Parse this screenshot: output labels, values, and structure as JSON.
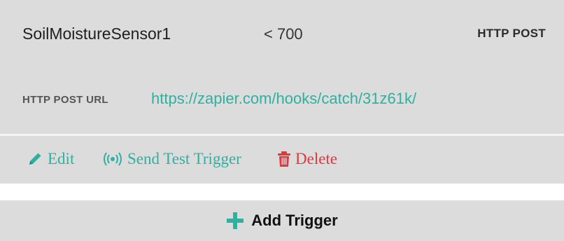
{
  "trigger": {
    "sensor_name": "SoilMoistureSensor1",
    "condition": "< 700",
    "method": "HTTP POST",
    "url_label": "HTTP POST URL",
    "url": "https://zapier.com/hooks/catch/31z61k/"
  },
  "actions": {
    "edit_label": "Edit",
    "test_label": "Send Test Trigger",
    "delete_label": "Delete"
  },
  "add_trigger": {
    "label": "Add Trigger"
  },
  "icons": {
    "edit": "pencil-icon",
    "test": "broadcast-icon",
    "delete": "trash-icon",
    "add": "plus-icon"
  },
  "colors": {
    "card_background": "#dcdcdc",
    "accent_teal": "#2fb0a0",
    "danger_red": "#e0383e",
    "text_dark": "#1f1f1f"
  }
}
